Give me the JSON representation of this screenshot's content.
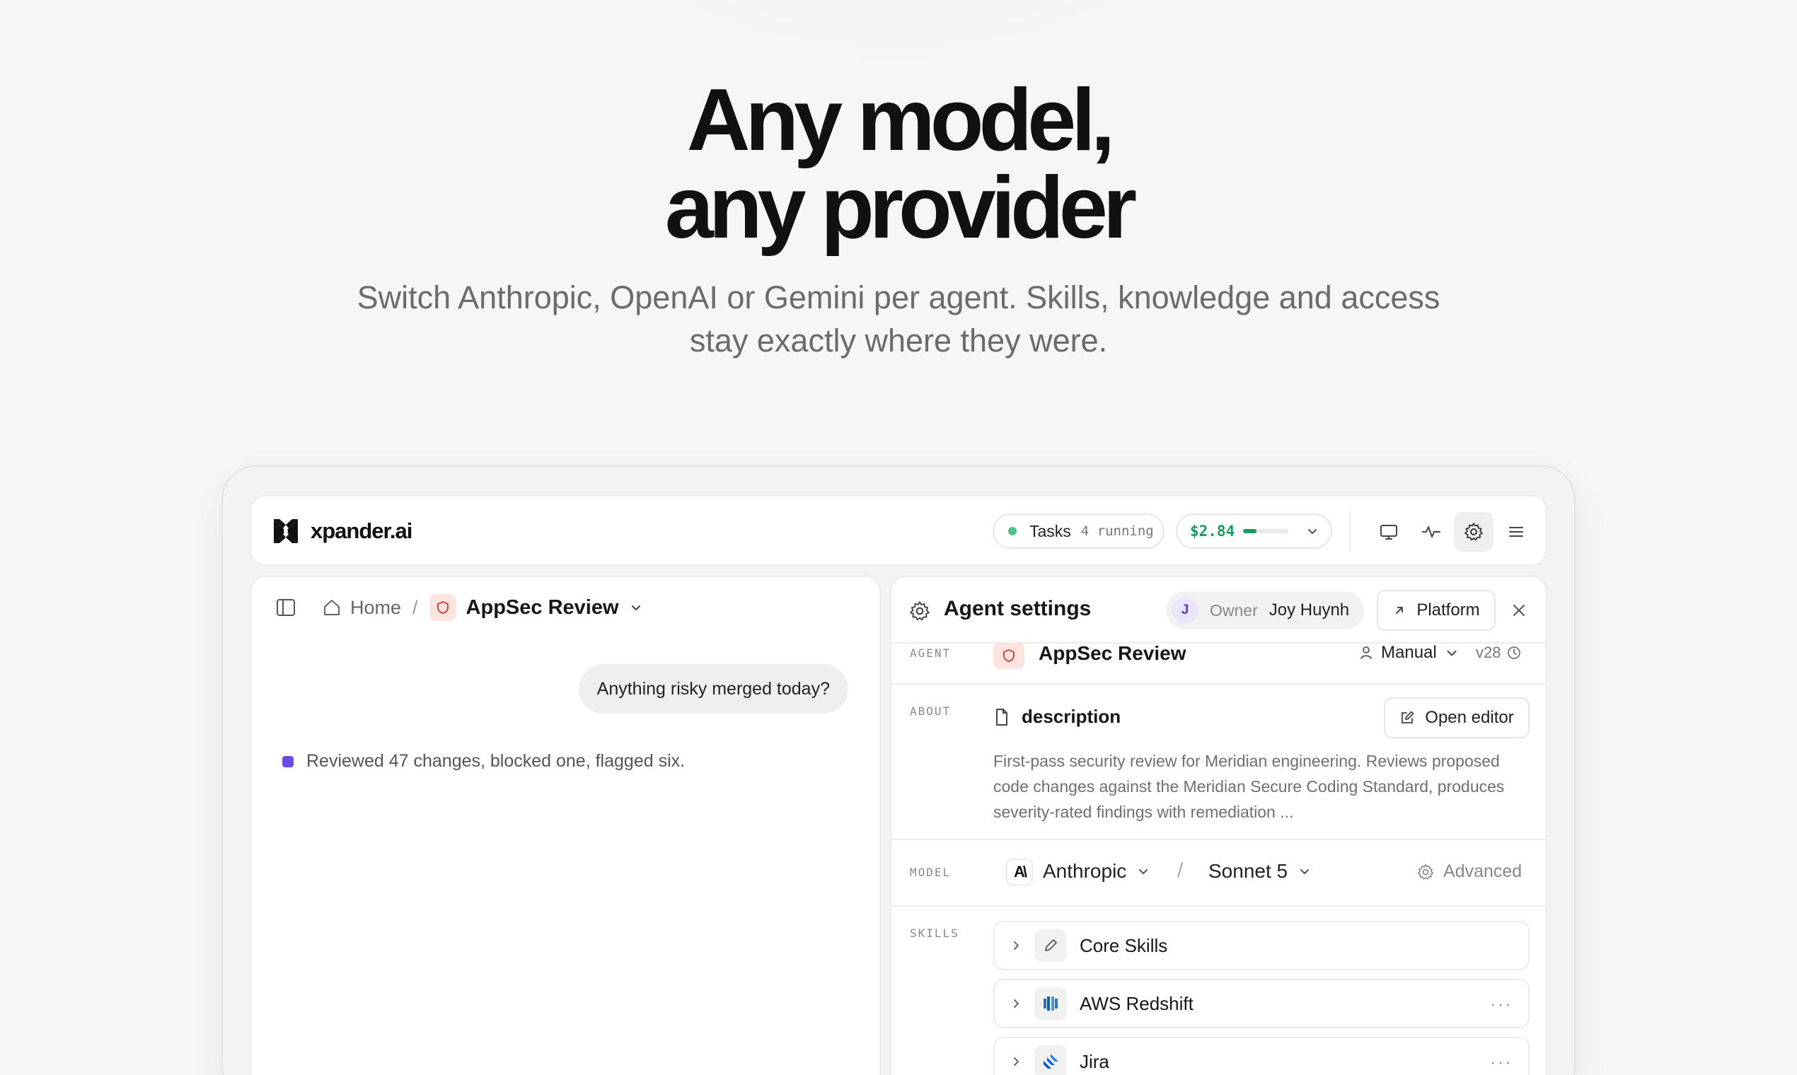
{
  "hero": {
    "title_line1": "Any model,",
    "title_line2": "any provider",
    "subtitle": "Switch Anthropic, OpenAI or Gemini per agent. Skills, knowledge and access stay exactly where they were."
  },
  "topbar": {
    "logo_text": "xpander.ai",
    "tasks_label": "Tasks",
    "tasks_count": "4 running",
    "cost": "$2.84",
    "cost_progress": 0.3,
    "icons": [
      "monitor-icon",
      "activity-icon",
      "settings-icon",
      "menu-icon"
    ],
    "colors": {
      "accent_green": "#1a9a60",
      "status_dot": "#4fbf8e"
    }
  },
  "chat": {
    "breadcrumb_home": "Home",
    "breadcrumb_sep": "/",
    "agent_name": "AppSec Review",
    "user_message": "Anything risky merged today?",
    "agent_reply": "Reviewed 47 changes, blocked one, flagged six."
  },
  "settings": {
    "title": "Agent settings",
    "owner_initial": "J",
    "owner_label": "Owner",
    "owner_name": "Joy Huynh",
    "platform_label": "Platform",
    "agent_label": "AGENT",
    "agent_name": "AppSec Review",
    "mode": "Manual",
    "version": "v28",
    "about_label": "ABOUT",
    "about_title": "description",
    "open_editor_label": "Open editor",
    "about_text": "First-pass security review for Meridian engineering. Reviews proposed code changes against the Meridian Secure Coding Standard, produces severity-rated findings with remediation ...",
    "model_label": "MODEL",
    "provider": "Anthropic",
    "provider_logo": "A\\",
    "model_sep": "/",
    "model_name": "Sonnet 5",
    "advanced_label": "Advanced",
    "skills_label": "SKILLS",
    "skills": [
      {
        "name": "Core Skills",
        "icon": "pencil-icon",
        "more": ""
      },
      {
        "name": "AWS Redshift",
        "icon": "redshift-icon",
        "more": "···"
      },
      {
        "name": "Jira",
        "icon": "jira-icon",
        "more": "···"
      }
    ]
  }
}
